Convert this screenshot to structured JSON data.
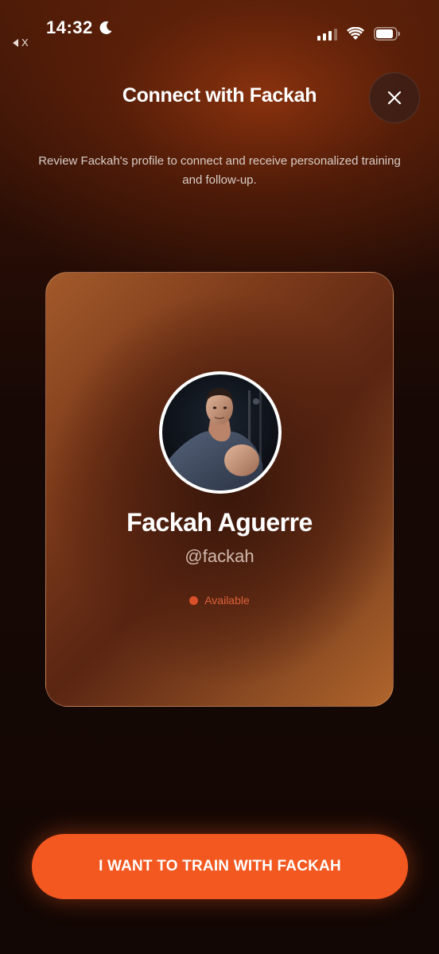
{
  "status_bar": {
    "time": "14:32",
    "back_app_label": "X"
  },
  "header": {
    "title": "Connect with Fackah",
    "close_icon": "close-icon"
  },
  "subtitle": "Review Fackah's profile to connect and receive personalized training and follow-up.",
  "profile": {
    "name": "Fackah Aguerre",
    "handle": "@fackah",
    "status": "Available",
    "status_color": "#d9512a"
  },
  "cta": {
    "label": "I WANT TO TRAIN WITH FACKAH",
    "color": "#f2581f"
  }
}
